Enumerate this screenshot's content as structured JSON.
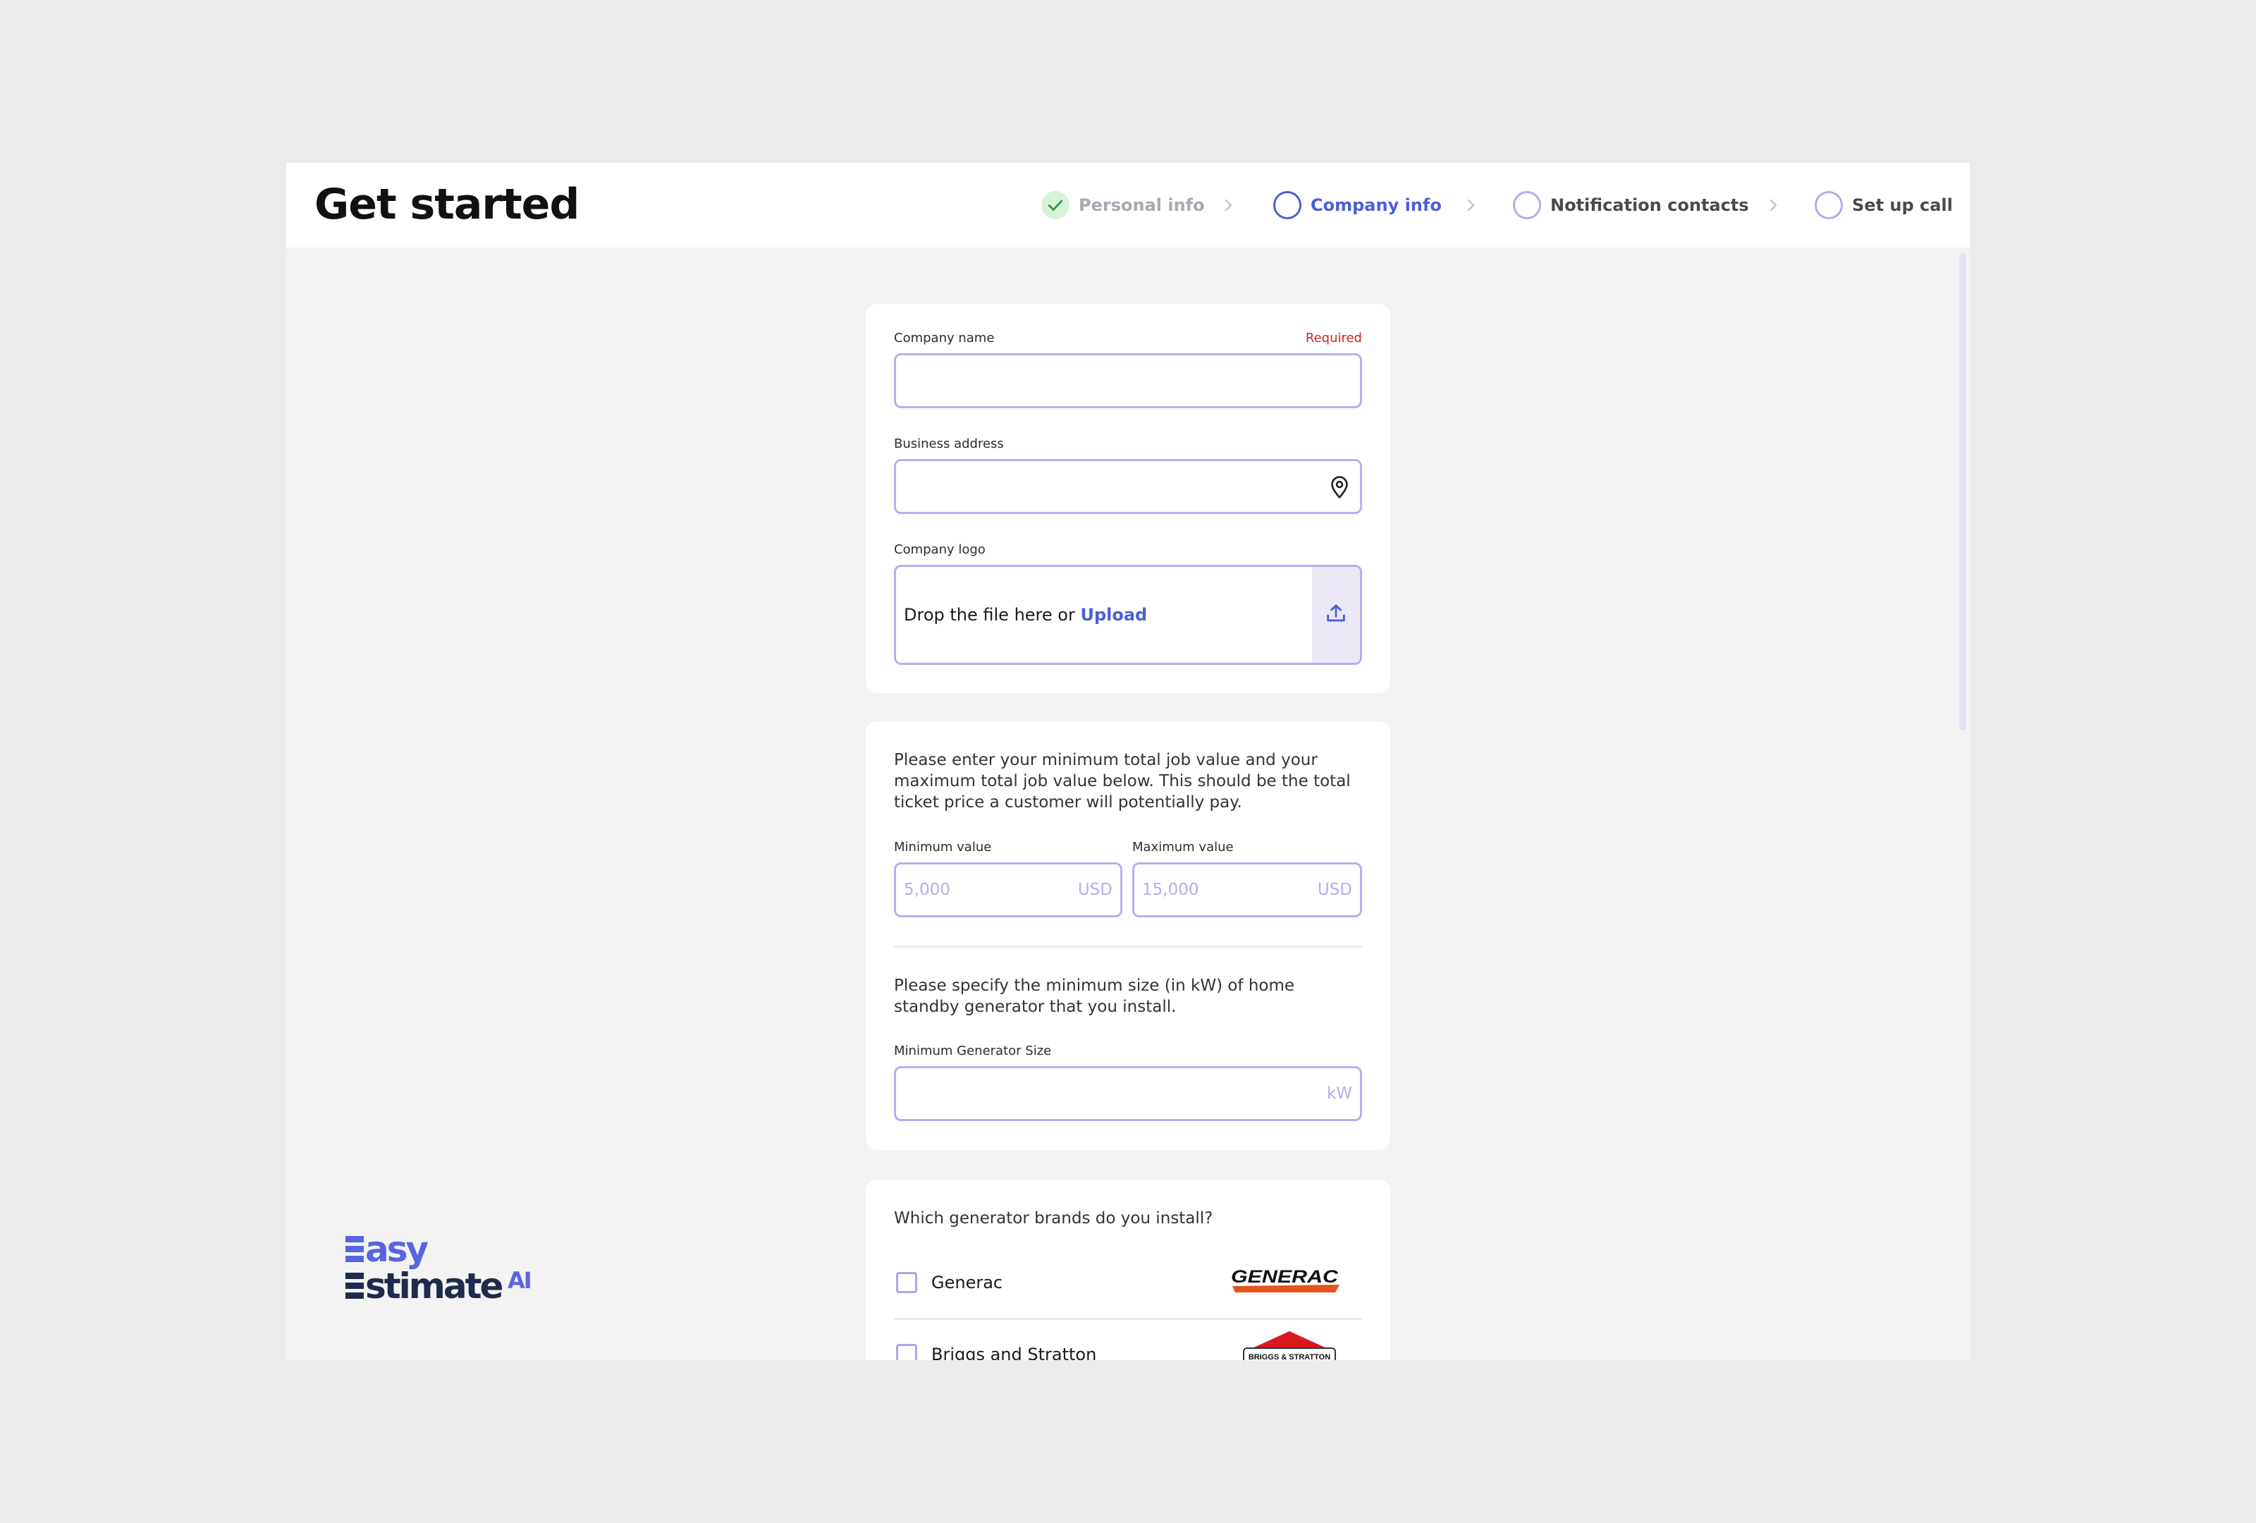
{
  "header": {
    "title": "Get started",
    "steps": [
      {
        "label": "Personal info",
        "status": "completed"
      },
      {
        "label": "Company info",
        "status": "active"
      },
      {
        "label": "Notification contacts",
        "status": "pending"
      },
      {
        "label": "Set up call",
        "status": "pending"
      }
    ]
  },
  "company_form": {
    "company_name_label": "Company name",
    "required_label": "Required",
    "company_name_value": "",
    "business_address_label": "Business address",
    "business_address_value": "",
    "company_logo_label": "Company logo",
    "dropzone_text": "Drop the file here or ",
    "upload_link": "Upload"
  },
  "job_values": {
    "instructions": "Please enter your minimum total job value and your maximum total job value below. This should be the total ticket price a customer will potentially pay.",
    "min_label": "Minimum value",
    "min_placeholder": "5,000",
    "min_currency": "USD",
    "max_label": "Maximum value",
    "max_placeholder": "15,000",
    "max_currency": "USD",
    "generator_instructions": "Please specify the minimum size (in kW) of home standby generator that you install.",
    "generator_label": "Minimum Generator Size",
    "generator_unit": "kW"
  },
  "brands": {
    "question": "Which generator brands do you install?",
    "items": [
      {
        "name": "Generac",
        "logo_text": "GENERAC",
        "checked": false
      },
      {
        "name": "Briggs and Stratton",
        "logo_text": "BRIGGS & STRATTON",
        "checked": false
      }
    ]
  },
  "logo": {
    "line1": "asy",
    "line2": "stimate",
    "suffix": "AI"
  },
  "colors": {
    "accent": "#4a5fd8",
    "input_border": "#b9adf1",
    "required": "#d42020",
    "success": "#2a9d3e",
    "logo_navy": "#1f2a4d",
    "logo_blue": "#5865e0",
    "generac_orange": "#e5531d",
    "briggs_red": "#d71920"
  }
}
